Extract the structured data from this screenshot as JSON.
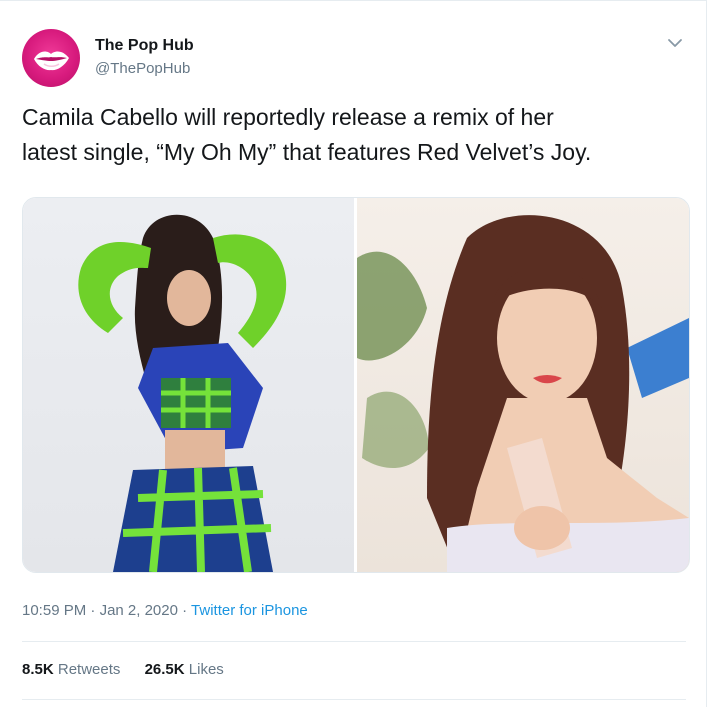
{
  "user": {
    "name": "The Pop Hub",
    "handle": "@ThePopHub"
  },
  "tweet": {
    "text": "Camila Cabello will reportedly release a remix of her\nlatest single, “My Oh My” that features Red Velvet’s Joy."
  },
  "media": {
    "photos": [
      "photo-left",
      "photo-right"
    ]
  },
  "meta": {
    "time": "10:59 PM",
    "sep1": " · ",
    "date": "Jan 2, 2020",
    "sep2": " · ",
    "source": "Twitter for iPhone"
  },
  "stats": {
    "retweets_count": "8.5K",
    "retweets_label": "Retweets",
    "likes_count": "26.5K",
    "likes_label": "Likes"
  },
  "icons": {
    "caret": "chevron-down-icon",
    "avatar": "lips-logo"
  },
  "colors": {
    "link": "#1b95e0",
    "secondary_text": "#657786",
    "avatar_pink": "#d81b7e"
  }
}
